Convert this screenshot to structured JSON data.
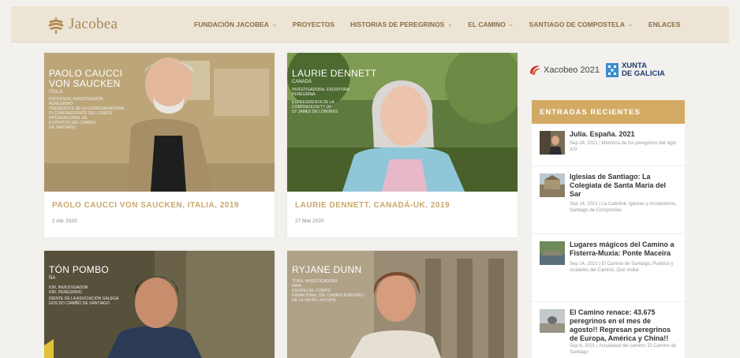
{
  "header": {
    "logo_text": "Jacobea",
    "nav": [
      {
        "label": "FUNDACIÓN JACOBEA",
        "has_caret": true
      },
      {
        "label": "PROYECTOS",
        "has_caret": false
      },
      {
        "label": "HISTORIAS DE PEREGRINOS",
        "has_caret": true
      },
      {
        "label": "EL CAMINO",
        "has_caret": true
      },
      {
        "label": "SANTIAGO DE COMPOSTELA",
        "has_caret": true
      },
      {
        "label": "ENLACES",
        "has_caret": false
      }
    ],
    "caret_glyph": "⌄"
  },
  "posts": [
    {
      "title": "PAOLO CAUCCI VON SAUCKEN, ITALIA, 2019",
      "date": "2 Abr 2020",
      "overlay_name_1": "PAOLO CAUCCI",
      "overlay_name_2": "VON SAUCKEN",
      "overlay_country": "ITALIA",
      "overlay_role": [
        "PROFESOR, INVESTIGADOR",
        "PEREGRINO",
        "PRESIDENTE DE LA CONFEDERAZIONE",
        "DI CONFRATERNITE DEL COMITÉ",
        "INTERNACIONAL DE",
        "EXPERTOS DEL CAMINO",
        "DE SANTIAGO"
      ]
    },
    {
      "title": "LAURIE DENNETT, CANADÁ-UK, 2019",
      "date": "27 Mar 2020",
      "overlay_name_1": "LAURIE DENNETT",
      "overlay_name_2": "",
      "overlay_country": "CANADÁ",
      "overlay_role": [
        "INVESTIGADORA, ESCRITORA",
        "PEREGRINA",
        "EXPRESIDENTA DE LA",
        "CONFRATERNITY OF",
        "ST JAMES DE LONDRES"
      ]
    },
    {
      "title": "",
      "date": "",
      "overlay_name_1": "TÓN POMBO",
      "overlay_name_2": "",
      "overlay_country": "ÑA",
      "overlay_role": [
        "IOR, INVESTIGADOR",
        "IOR, PEREGRINO",
        "IDENTE DE LA ASOCIACIÓN GALEGA",
        "GOS DO CAMIÑO DE SANTIAGO"
      ]
    },
    {
      "title": "",
      "date": "",
      "overlay_name_1": "RYJANE DUNN",
      "overlay_name_2": "",
      "overlay_country": "",
      "overlay_role": [
        "TORA, INVESTIGADORA",
        "RINA",
        "IDENTA DEL COMITÉ",
        "ERNACIONAL DEL CAMINO EUROPEO",
        "DE LA VÍA DE LA PLATA"
      ]
    }
  ],
  "sidebar": {
    "sponsor_xacobeo": "Xacobeo 2021",
    "sponsor_xunta_1": "XUNTA",
    "sponsor_xunta_2": "DE GALICIA",
    "recent_title": "ENTRADAS RECIENTES",
    "recent": [
      {
        "title": "Julia. España. 2021",
        "meta": "Sep 24, 2021 | Memoria de los peregrinos del siglo XXI"
      },
      {
        "title": "Iglesias de Santiago: La Colegiata de Santa María del Sar",
        "meta": "Sep 14, 2021 | La Catedral, iglesias y monasterios, Santiago de Compostela"
      },
      {
        "title": "Lugares mágicos del Camino a Fisterra-Muxía: Ponte Maceira",
        "meta": "Sep 14, 2021 | El Camino de Santiago, Pueblos y ciudades del Camino, Qué visitar"
      },
      {
        "title": "El Camino renace: 43.675 peregrinos en el mes de agosto!! Regresan peregrinos de Europa, América y China!!",
        "meta": "Sep 6, 2021 | Actualidad del camino, El Camino de Santiago"
      }
    ]
  }
}
